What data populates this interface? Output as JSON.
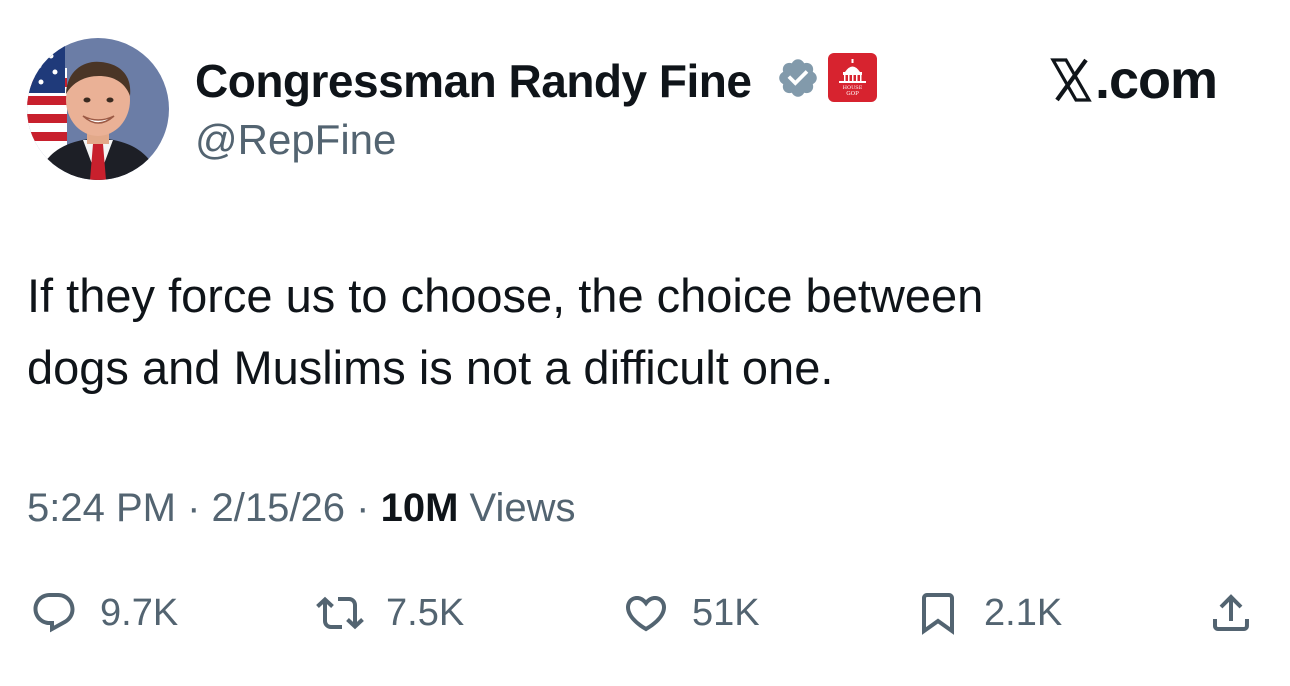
{
  "author": {
    "display_name": "Congressman Randy Fine",
    "handle": "@RepFine",
    "verified_badge_icon": "verified-badge-icon",
    "affiliation_badge_icon": "house-gop-capitol-icon",
    "affiliation_badge_lines": [
      "HOUSE",
      "GOP"
    ],
    "badge_color": "#829aab",
    "affiliation_color": "#d7232f"
  },
  "site": {
    "text": ".com",
    "logo_icon": "x-logo-icon"
  },
  "tweet": {
    "lines": [
      "If they force us to choose, the choice between",
      "dogs and Muslims is not a difficult one."
    ]
  },
  "meta": {
    "time": "5:24 PM",
    "separator": "·",
    "date": "2/15/26",
    "views_count": "10M",
    "views_label": "Views"
  },
  "actions": {
    "reply": {
      "icon": "reply-icon",
      "count": "9.7K"
    },
    "repost": {
      "icon": "repost-icon",
      "count": "7.5K"
    },
    "like": {
      "icon": "heart-icon",
      "count": "51K"
    },
    "bookmark": {
      "icon": "bookmark-icon",
      "count": "2.1K"
    },
    "share": {
      "icon": "share-icon"
    }
  },
  "colors": {
    "text_primary": "#0f1419",
    "text_secondary": "#536471"
  }
}
